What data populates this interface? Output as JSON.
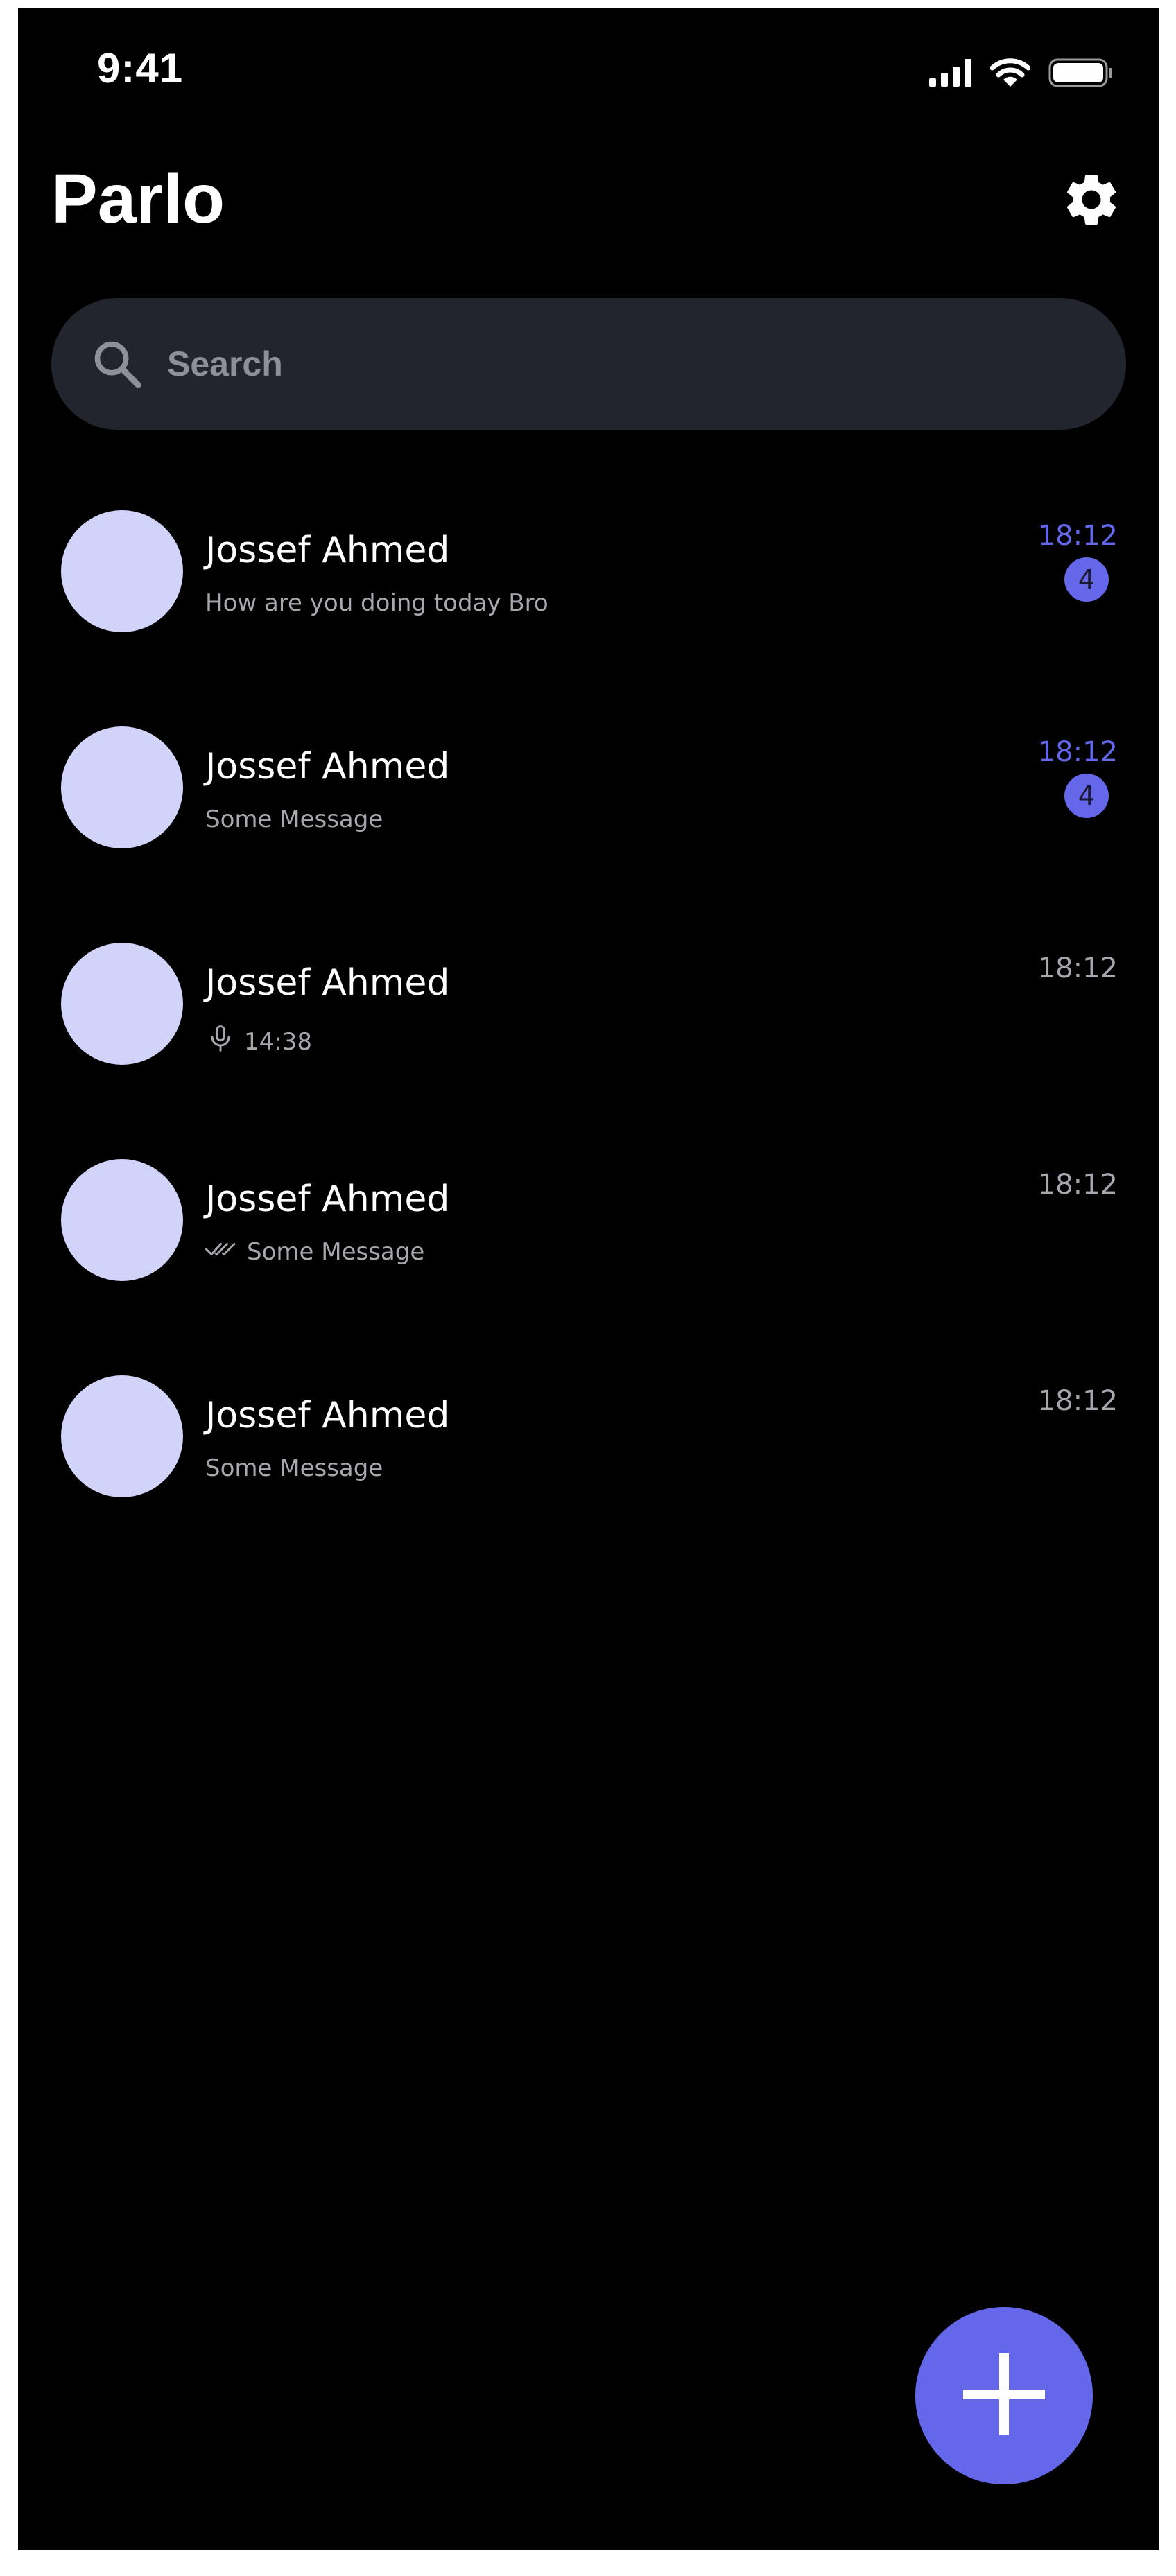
{
  "status_bar": {
    "time": "9:41",
    "icons": [
      "signal-icon",
      "wifi-icon",
      "battery-icon"
    ]
  },
  "header": {
    "title": "Parlo",
    "settings_icon": "gear-icon"
  },
  "search": {
    "placeholder": "Search",
    "icon": "search-icon"
  },
  "chats": [
    {
      "name": "Jossef Ahmed",
      "preview": "How are you doing today Bro",
      "time": "18:12",
      "unread_count": "4",
      "unread": true,
      "preview_icon": null
    },
    {
      "name": "Jossef Ahmed",
      "preview": "Some Message",
      "time": "18:12",
      "unread_count": "4",
      "unread": true,
      "preview_icon": null
    },
    {
      "name": "Jossef Ahmed",
      "preview": "14:38",
      "time": "18:12",
      "unread_count": null,
      "unread": false,
      "preview_icon": "microphone-icon"
    },
    {
      "name": "Jossef Ahmed",
      "preview": "Some Message",
      "time": "18:12",
      "unread_count": null,
      "unread": false,
      "preview_icon": "double-check-icon"
    },
    {
      "name": "Jossef Ahmed",
      "preview": "Some Message",
      "time": "18:12",
      "unread_count": null,
      "unread": false,
      "preview_icon": null
    }
  ],
  "fab": {
    "icon": "plus-icon"
  },
  "colors": {
    "background": "#000000",
    "accent": "#6467ea",
    "avatar": "#d1d3f8",
    "search_bg": "#22252d",
    "muted_text": "#a7a8ae"
  }
}
